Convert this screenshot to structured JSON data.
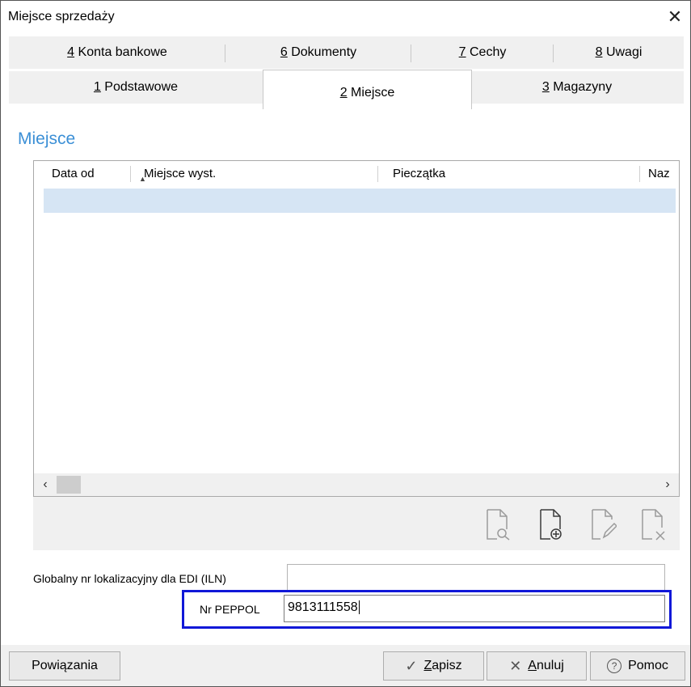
{
  "window": {
    "title": "Miejsce sprzedaży",
    "close_glyph": "✕"
  },
  "tabs_row1": [
    {
      "label": "4 Konta bankowe",
      "key": "4",
      "rest": " Konta bankowe"
    },
    {
      "label": "6 Dokumenty",
      "key": "6",
      "rest": " Dokumenty"
    },
    {
      "label": "7 Cechy",
      "key": "7",
      "rest": " Cechy"
    },
    {
      "label": "8 Uwagi",
      "key": "8",
      "rest": " Uwagi"
    }
  ],
  "tabs_row2": [
    {
      "label": "1 Podstawowe",
      "key": "1",
      "rest": " Podstawowe"
    },
    {
      "label": "2 Miejsce",
      "key": "2",
      "rest": " Miejsce",
      "active": true
    },
    {
      "label": "3 Magazyny",
      "key": "3",
      "rest": " Magazyny"
    }
  ],
  "section": {
    "heading": "Miejsce"
  },
  "grid": {
    "columns": [
      "Data od",
      "Miejsce wyst.",
      "Pieczątka",
      "Naz"
    ],
    "sorted_column": "Data od",
    "rows": [],
    "scroll_left": "‹",
    "scroll_right": "›"
  },
  "toolbar_icons": [
    "preview-document-icon",
    "add-document-icon",
    "edit-document-icon",
    "delete-document-icon"
  ],
  "fields": {
    "iln_label": "Globalny nr lokalizacyjny dla EDI (ILN)",
    "iln_value": "",
    "peppol_label": "Nr PEPPOL",
    "peppol_value": "9813111558"
  },
  "buttons": {
    "links": "Powiązania",
    "save_key": "Z",
    "save_rest": "apisz",
    "cancel_key": "A",
    "cancel_rest": "nuluj",
    "help": "Pomoc"
  },
  "colors": {
    "heading": "#3b8fd6",
    "selected_row": "#d6e5f4",
    "focus_frame": "#1018d8"
  }
}
